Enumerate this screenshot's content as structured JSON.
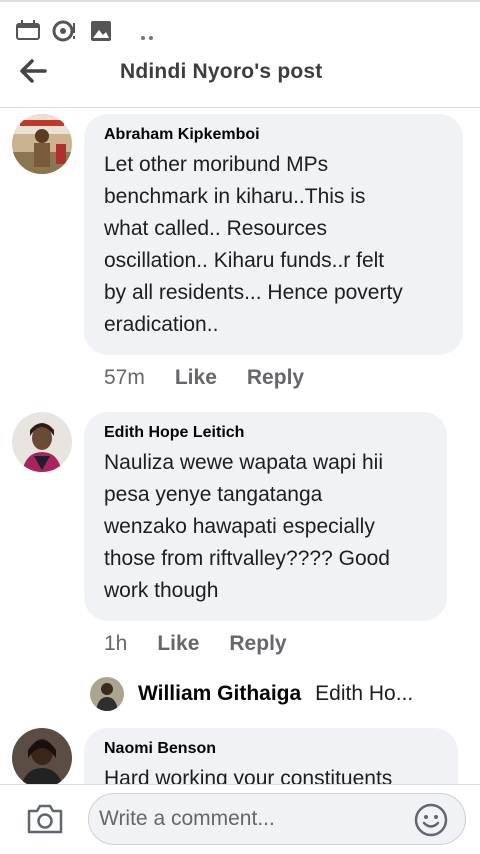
{
  "status_bar": {
    "icons": [
      "calendar-icon",
      "sync-icon",
      "image-icon",
      "more-dots-icon"
    ]
  },
  "header": {
    "title": "Ndindi Nyoro's post",
    "back_icon": "arrow-left-icon"
  },
  "comments": [
    {
      "author": "Abraham Kipkemboi",
      "text": "Let other moribund MPs\nbenchmark in kiharu..This is\nwhat called.. Resources\noscillation.. Kiharu funds..r felt\nby all residents... Hence poverty\neradication..",
      "time": "57m",
      "like_label": "Like",
      "reply_label": "Reply"
    },
    {
      "author": "Edith Hope Leitich",
      "text": "Nauliza wewe wapata wapi hii\npesa yenye tangatanga\nwenzako hawapati especially\nthose from riftvalley???? Good\nwork though",
      "time": "1h",
      "like_label": "Like",
      "reply_label": "Reply"
    },
    {
      "author": "Naomi Benson",
      "text": "Hard working your constituents"
    }
  ],
  "reply_preview": {
    "name": "William Githaiga",
    "snippet": "Edith Ho..."
  },
  "composer": {
    "placeholder": "Write a comment...",
    "camera_icon": "camera-icon",
    "emoji_icon": "emoji-icon"
  }
}
